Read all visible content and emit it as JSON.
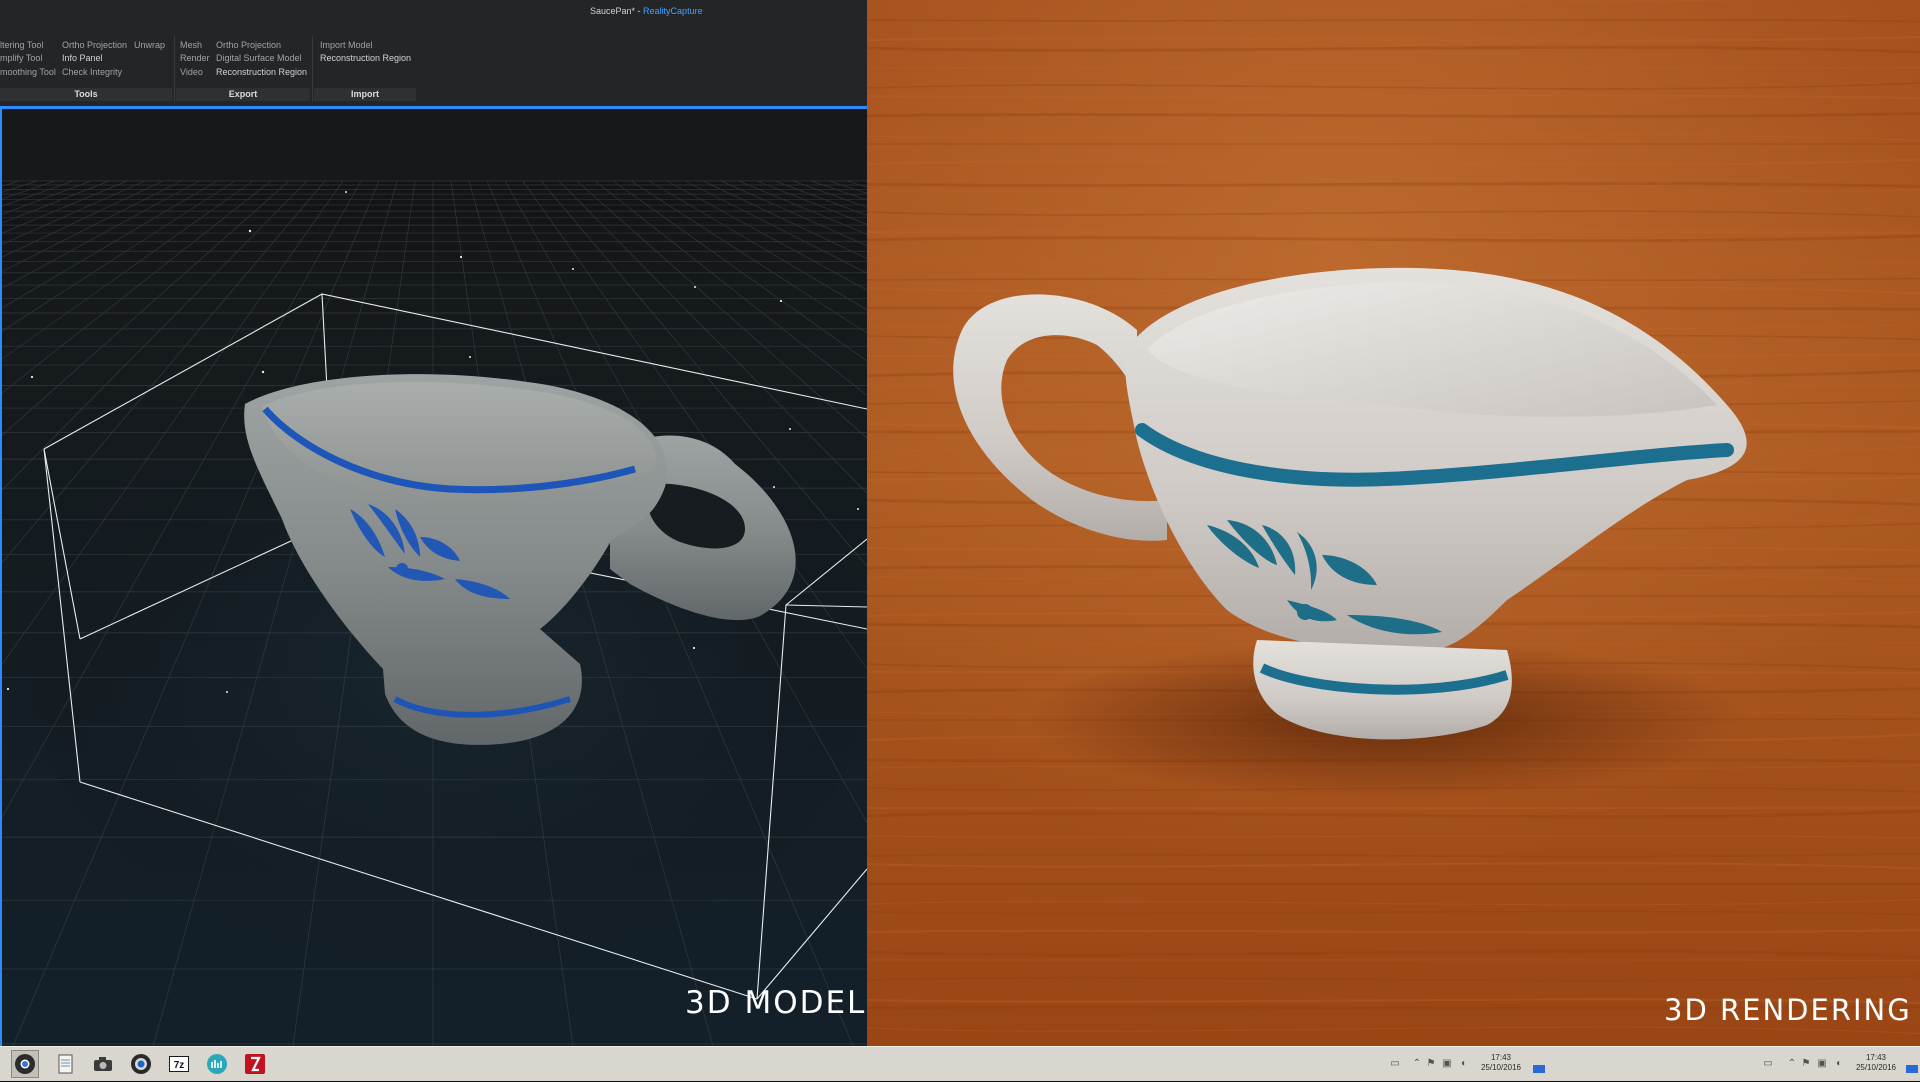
{
  "window": {
    "document": "SaucePan*",
    "separator": " - ",
    "app_name": "RealityCapture"
  },
  "ribbon": {
    "tools": {
      "label": "Tools",
      "col1": [
        "ltering Tool",
        "mplify Tool",
        "moothing Tool"
      ],
      "col2": [
        "Ortho Projection",
        "Info Panel",
        "Check Integrity"
      ],
      "col3": [
        "Unwrap"
      ]
    },
    "export": {
      "label": "Export",
      "col1": [
        "Mesh",
        "Render",
        "Video"
      ],
      "col2": [
        "Ortho Projection",
        "Digital Surface Model",
        "Reconstruction Region"
      ]
    },
    "import": {
      "label": "Import",
      "items": [
        "Import Model",
        "Reconstruction Region"
      ]
    }
  },
  "captions": {
    "left": "3D MODEL",
    "right": "3D RENDERING"
  },
  "taskbar": {
    "apps": [
      {
        "icon": "chrome-icon",
        "active": true
      },
      {
        "icon": "notepad-icon",
        "active": false
      },
      {
        "icon": "camera-icon",
        "active": false
      },
      {
        "icon": "obs-icon",
        "active": false
      },
      {
        "icon": "7zip-icon",
        "active": false
      },
      {
        "icon": "realitycapture-icon",
        "active": false
      },
      {
        "icon": "filezilla-icon",
        "active": false
      }
    ],
    "clock_left": {
      "time": "17:43",
      "date": "25/10/2016"
    },
    "clock_right": {
      "time": "17:43",
      "date": "25/10/2016"
    }
  },
  "colors": {
    "accent_blue": "#2e8bff",
    "ribbon_bg": "#242527",
    "wood": "#a4491a",
    "glaze_blue": "#1d6f8e"
  }
}
